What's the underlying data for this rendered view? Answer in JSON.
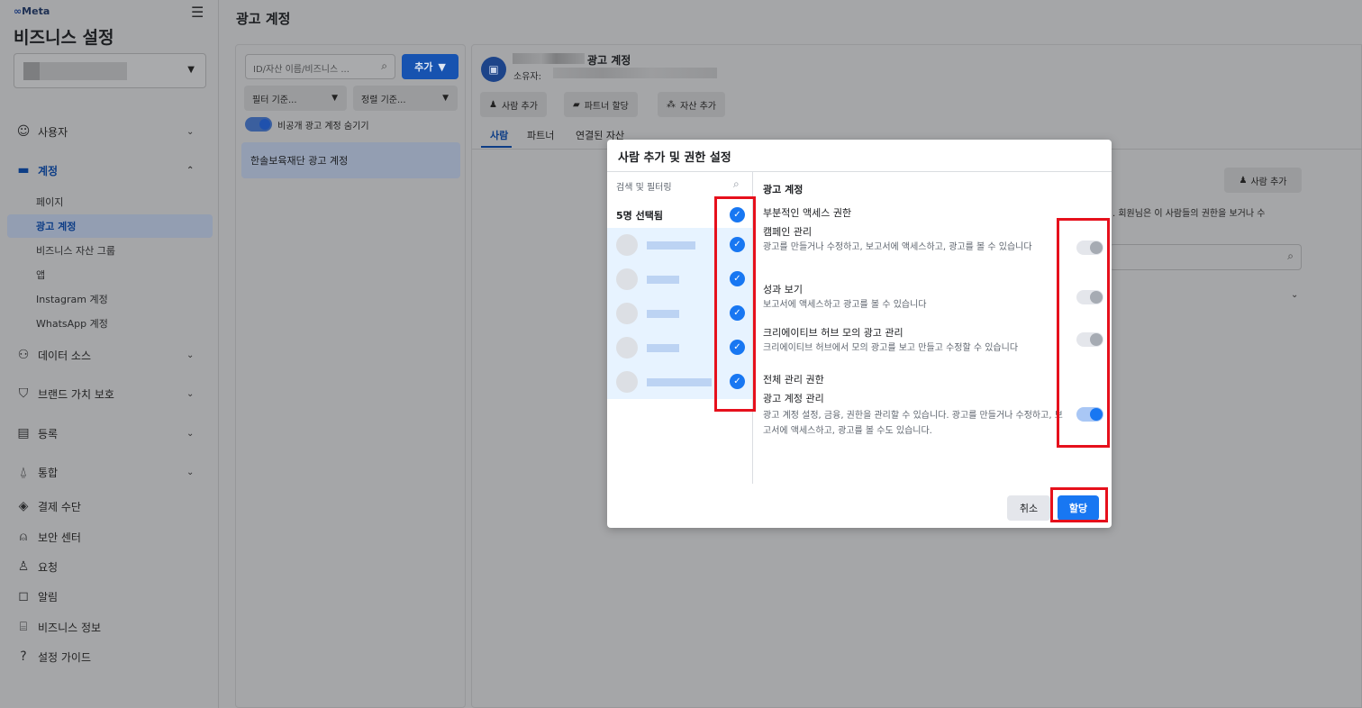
{
  "sidebar": {
    "logo": "Meta",
    "title": "비즈니스 설정",
    "nav": [
      {
        "label": "사용자",
        "icon": "users-icon"
      },
      {
        "label": "계정",
        "icon": "folder-icon"
      },
      {
        "label": "데이터 소스",
        "icon": "data-source-icon"
      },
      {
        "label": "브랜드 가치 보호",
        "icon": "shield-icon"
      },
      {
        "label": "등록",
        "icon": "clipboard-icon"
      },
      {
        "label": "통합",
        "icon": "integrations-icon"
      },
      {
        "label": "결제 수단",
        "icon": "payment-icon"
      },
      {
        "label": "보안 센터",
        "icon": "lock-icon"
      },
      {
        "label": "요청",
        "icon": "request-icon"
      },
      {
        "label": "알림",
        "icon": "notification-icon"
      },
      {
        "label": "비즈니스 정보",
        "icon": "briefcase-icon"
      },
      {
        "label": "설정 가이드",
        "icon": "help-icon"
      }
    ],
    "sub_items": [
      "페이지",
      "광고 계정",
      "비즈니스 자산 그룹",
      "앱",
      "Instagram 계정",
      "WhatsApp 계정"
    ]
  },
  "main": {
    "title": "광고 계정",
    "search_placeholder": "ID/자산 이름/비즈니스 ...",
    "add_label": "추가",
    "filter_label": "필터 기준...",
    "sort_label": "정렬 기준...",
    "hide_toggle_label": "비공개 광고 계정 숨기기",
    "account_item": "한솔보육재단 광고 계정"
  },
  "detail": {
    "account_suffix": "광고 계정",
    "owner_label": "소유자:",
    "buttons": [
      "사람 추가",
      "파트너 할당",
      "자산 추가"
    ],
    "tabs": [
      "사람",
      "파트너",
      "연결된 자산"
    ],
    "right_add": "사람 추가",
    "right_desc": ". 회원님은 이 사람들의 권한을 보거나 수"
  },
  "modal": {
    "title": "사람 추가 및 권한 설정",
    "search_placeholder": "검색 및 필터링",
    "selected_count": "5명 선택됨",
    "section": "광고 계정",
    "partial_heading": "부분적인 액세스 권한",
    "perms": [
      {
        "title": "캠페인 관리",
        "desc": "광고를 만들거나 수정하고, 보고서에 액세스하고, 광고를 볼 수 있습니다",
        "on": false
      },
      {
        "title": "성과 보기",
        "desc": "보고서에 액세스하고 광고를 볼 수 있습니다",
        "on": false
      },
      {
        "title": "크리에이티브 허브 모의 광고 관리",
        "desc": "크리에이티브 허브에서 모의 광고를 보고 만들고 수정할 수 있습니다",
        "on": false
      }
    ],
    "full_heading": "전체 관리 권한",
    "full_perm": {
      "title": "광고 계정 관리",
      "desc": "광고 계정 설정, 금융, 권한을 관리할 수 있습니다. 광고를 만들거나 수정하고, 보고서에 액세스하고, 광고를 볼 수도 있습니다.",
      "on": true
    },
    "cancel": "취소",
    "assign": "할당"
  },
  "colors": {
    "accent": "#1877f2",
    "highlight": "#e6101c"
  }
}
